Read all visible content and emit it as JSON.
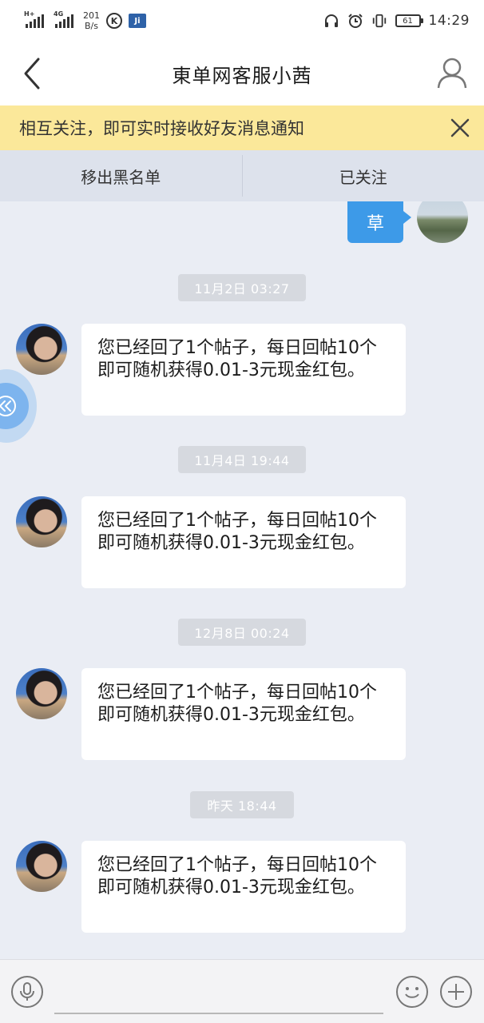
{
  "status_bar": {
    "signal1_label": "H+",
    "signal2_label": "4G",
    "net_speed_value": "201",
    "net_speed_unit": "B/s",
    "app_k_label": "K",
    "app_badge_label": "Ji",
    "battery": "61",
    "time": "14:29"
  },
  "header": {
    "title": "東单网客服小茜",
    "back_icon": "chevron-left-icon",
    "profile_icon": "user-icon"
  },
  "notice": {
    "text": "相互关注，即可实时接收好友消息通知",
    "close_icon": "close-icon"
  },
  "actions": {
    "remove_blacklist": "移出黑名单",
    "followed": "已关注"
  },
  "chat": {
    "outgoing_text": "草",
    "messages": [
      {
        "time": "11月2日 03:27",
        "text": "您已经回了1个帖子，每日回帖10个即可随机获得0.01-3元现金红包。"
      },
      {
        "time": "11月4日 19:44",
        "text": "您已经回了1个帖子，每日回帖10个即可随机获得0.01-3元现金红包。"
      },
      {
        "time": "12月8日 00:24",
        "text": "您已经回了1个帖子，每日回帖10个即可随机获得0.01-3元现金红包。"
      },
      {
        "time": "昨天 18:44",
        "text": "您已经回了1个帖子，每日回帖10个即可随机获得0.01-3元现金红包。"
      }
    ]
  },
  "input_bar": {
    "mic_icon": "microphone-icon",
    "emoji_icon": "smiley-icon",
    "plus_icon": "plus-icon"
  },
  "colors": {
    "accent_blue": "#3d9ae8",
    "notice_bg": "#fbe89a",
    "chat_bg": "#eaedf4"
  }
}
